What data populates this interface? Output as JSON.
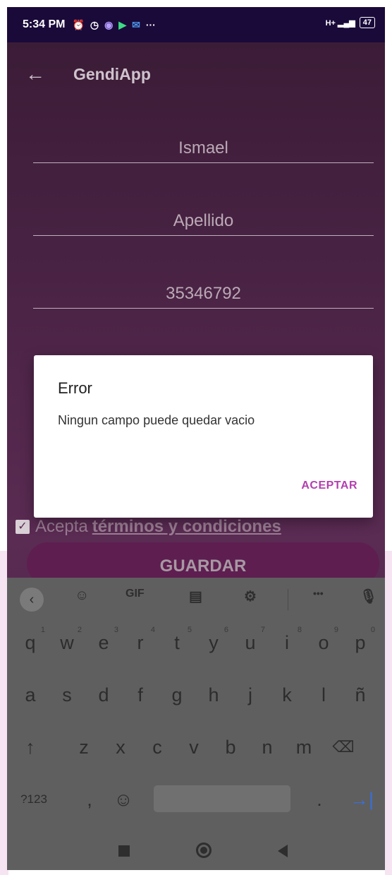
{
  "status": {
    "time": "5:34 PM",
    "battery": "47",
    "signal": "H+"
  },
  "toolbar": {
    "title": "GendiApp"
  },
  "form": {
    "first_name": "Ismael",
    "last_name_placeholder": "Apellido",
    "document": "35346792",
    "terms_prefix": "Acepta",
    "terms_link": "términos y condiciones",
    "save_label": "GUARDAR"
  },
  "dialog": {
    "title": "Error",
    "message": "Ningun campo puede quedar vacio",
    "accept_label": "ACEPTAR"
  },
  "keyboard": {
    "toolbar": {
      "gif": "GIF",
      "more": "•••"
    },
    "row1": [
      "q",
      "w",
      "e",
      "r",
      "t",
      "y",
      "u",
      "i",
      "o",
      "p"
    ],
    "row1_hints": [
      "1",
      "2",
      "3",
      "4",
      "5",
      "6",
      "7",
      "8",
      "9",
      "0"
    ],
    "row2": [
      "a",
      "s",
      "d",
      "f",
      "g",
      "h",
      "j",
      "k",
      "l",
      "ñ"
    ],
    "row3": [
      "z",
      "x",
      "c",
      "v",
      "b",
      "n",
      "m"
    ],
    "symbols_label": "?123",
    "comma": ",",
    "period": "."
  },
  "colors": {
    "accent": "#b23fb0",
    "status_bar": "#1a0a3a",
    "app_bg": "#4b2446",
    "button": "#5e1e50"
  }
}
